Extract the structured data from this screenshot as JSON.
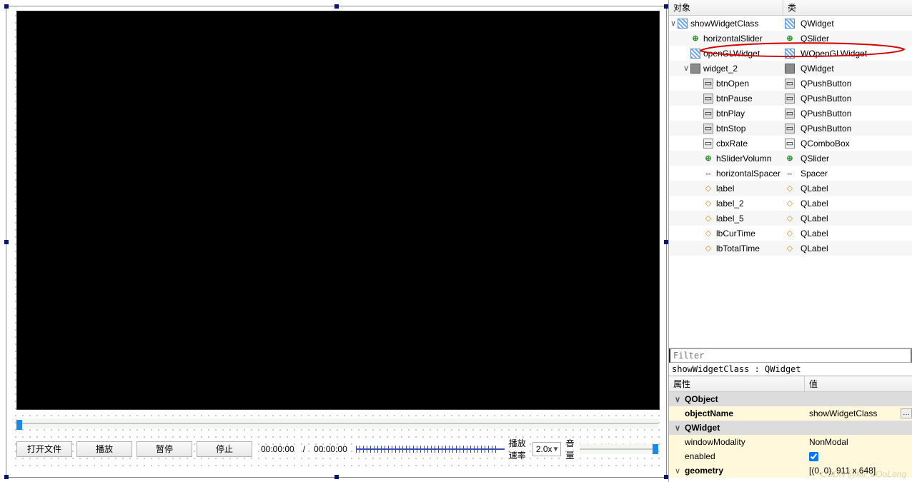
{
  "tree": {
    "header_obj": "对象",
    "header_class": "类",
    "rows": [
      {
        "name": "showWidgetClass",
        "class": "QWidget",
        "indent": 0,
        "expander": "∨",
        "icon": "widget-icon"
      },
      {
        "name": "horizontalSlider",
        "class": "QSlider",
        "indent": 1,
        "expander": "",
        "icon": "slider-icon"
      },
      {
        "name": "openGLWidget",
        "class": "WOpenGLWidget",
        "indent": 1,
        "expander": "",
        "icon": "widget-icon",
        "highlight": true
      },
      {
        "name": "widget_2",
        "class": "QWidget",
        "indent": 1,
        "expander": "∨",
        "icon": "layout-icon"
      },
      {
        "name": "btnOpen",
        "class": "QPushButton",
        "indent": 2,
        "expander": "",
        "icon": "button-icon"
      },
      {
        "name": "btnPause",
        "class": "QPushButton",
        "indent": 2,
        "expander": "",
        "icon": "button-icon"
      },
      {
        "name": "btnPlay",
        "class": "QPushButton",
        "indent": 2,
        "expander": "",
        "icon": "button-icon"
      },
      {
        "name": "btnStop",
        "class": "QPushButton",
        "indent": 2,
        "expander": "",
        "icon": "button-icon"
      },
      {
        "name": "cbxRate",
        "class": "QComboBox",
        "indent": 2,
        "expander": "",
        "icon": "combo-icon"
      },
      {
        "name": "hSliderVolumn",
        "class": "QSlider",
        "indent": 2,
        "expander": "",
        "icon": "slider-icon"
      },
      {
        "name": "horizontalSpacer",
        "class": "Spacer",
        "indent": 2,
        "expander": "",
        "icon": "spacer-icon"
      },
      {
        "name": "label",
        "class": "QLabel",
        "indent": 2,
        "expander": "",
        "icon": "label-icon"
      },
      {
        "name": "label_2",
        "class": "QLabel",
        "indent": 2,
        "expander": "",
        "icon": "label-icon"
      },
      {
        "name": "label_5",
        "class": "QLabel",
        "indent": 2,
        "expander": "",
        "icon": "label-icon"
      },
      {
        "name": "lbCurTime",
        "class": "QLabel",
        "indent": 2,
        "expander": "",
        "icon": "label-icon"
      },
      {
        "name": "lbTotalTime",
        "class": "QLabel",
        "indent": 2,
        "expander": "",
        "icon": "label-icon"
      }
    ]
  },
  "controls": {
    "open": "打开文件",
    "play": "播放",
    "pause": "暂停",
    "stop": "停止",
    "cur": "00:00:00",
    "sep": "/",
    "total": "00:00:00",
    "rate_label": "播放速率",
    "rate_value": "2.0x",
    "volume": "音量"
  },
  "filter_placeholder": "Filter",
  "crumb": "showWidgetClass : QWidget",
  "props": {
    "header_name": "属性",
    "header_value": "值",
    "group_qobject": "QObject",
    "objectName_k": "objectName",
    "objectName_v": "showWidgetClass",
    "group_qwidget": "QWidget",
    "windowModality_k": "windowModality",
    "windowModality_v": "NonModal",
    "enabled_k": "enabled",
    "geometry_k": "geometry",
    "geometry_v": "[(0, 0), 911 x 648]"
  },
  "watermark": "CSDN @Mr_oOoLong"
}
